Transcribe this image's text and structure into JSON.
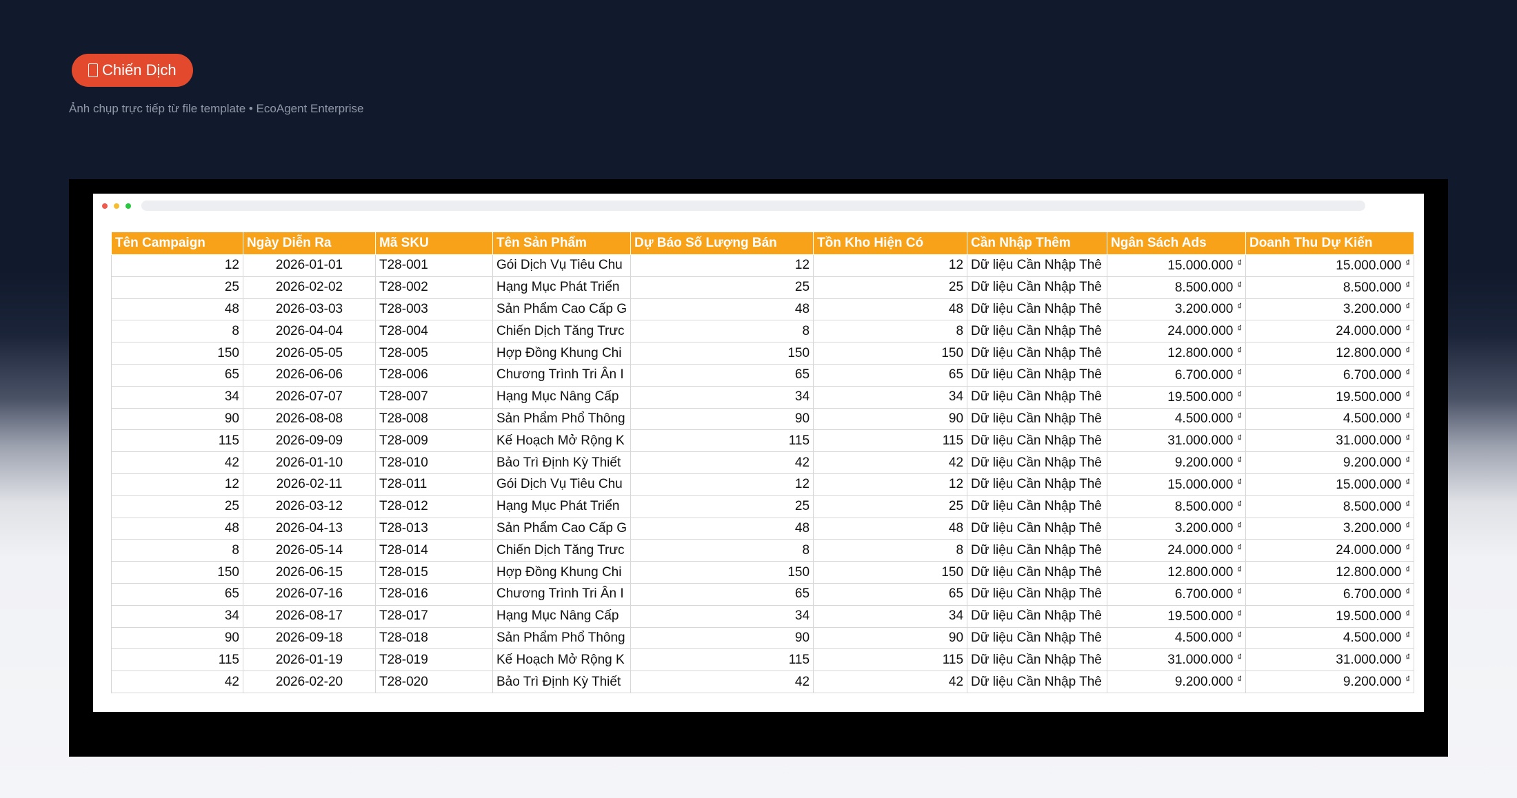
{
  "badge": {
    "icon": "document-icon",
    "label": "Chiến Dịch",
    "color": "#e2492d"
  },
  "caption": "Ảnh chụp trực tiếp từ file template • EcoAgent Enterprise",
  "window": {
    "dot_colors": [
      "#f05b50",
      "#f6be2f",
      "#29c840"
    ]
  },
  "sheet": {
    "header_color": "#f8a21a",
    "currency_symbol": "₫",
    "columns": [
      "Tên Campaign",
      "Ngày Diễn Ra",
      "Mã SKU",
      "Tên Sản Phẩm",
      "Dự Báo Số Lượng Bán",
      "Tồn Kho Hiện Có",
      "Cần Nhập Thêm",
      "Ngân Sách Ads",
      "Doanh Thu Dự Kiến"
    ],
    "rows": [
      [
        "12",
        "2026-01-01",
        "T28-001",
        "Gói Dịch Vụ Tiêu Chu",
        "12",
        "12",
        "Dữ liệu Cần Nhập Thê",
        "15.000.000",
        "15.000.000"
      ],
      [
        "25",
        "2026-02-02",
        "T28-002",
        "Hạng Mục Phát Triển",
        "25",
        "25",
        "Dữ liệu Cần Nhập Thê",
        "8.500.000",
        "8.500.000"
      ],
      [
        "48",
        "2026-03-03",
        "T28-003",
        "Sản Phẩm Cao Cấp G",
        "48",
        "48",
        "Dữ liệu Cần Nhập Thê",
        "3.200.000",
        "3.200.000"
      ],
      [
        "8",
        "2026-04-04",
        "T28-004",
        "Chiến Dịch Tăng Trưc",
        "8",
        "8",
        "Dữ liệu Cần Nhập Thê",
        "24.000.000",
        "24.000.000"
      ],
      [
        "150",
        "2026-05-05",
        "T28-005",
        "Hợp Đồng Khung Chi",
        "150",
        "150",
        "Dữ liệu Cần Nhập Thê",
        "12.800.000",
        "12.800.000"
      ],
      [
        "65",
        "2026-06-06",
        "T28-006",
        "Chương Trình Tri Ân I",
        "65",
        "65",
        "Dữ liệu Cần Nhập Thê",
        "6.700.000",
        "6.700.000"
      ],
      [
        "34",
        "2026-07-07",
        "T28-007",
        "Hạng Mục Nâng Cấp",
        "34",
        "34",
        "Dữ liệu Cần Nhập Thê",
        "19.500.000",
        "19.500.000"
      ],
      [
        "90",
        "2026-08-08",
        "T28-008",
        "Sản Phẩm Phổ Thông",
        "90",
        "90",
        "Dữ liệu Cần Nhập Thê",
        "4.500.000",
        "4.500.000"
      ],
      [
        "115",
        "2026-09-09",
        "T28-009",
        "Kế Hoạch Mở Rộng K",
        "115",
        "115",
        "Dữ liệu Cần Nhập Thê",
        "31.000.000",
        "31.000.000"
      ],
      [
        "42",
        "2026-01-10",
        "T28-010",
        "Bảo Trì Định Kỳ Thiết",
        "42",
        "42",
        "Dữ liệu Cần Nhập Thê",
        "9.200.000",
        "9.200.000"
      ],
      [
        "12",
        "2026-02-11",
        "T28-011",
        "Gói Dịch Vụ Tiêu Chu",
        "12",
        "12",
        "Dữ liệu Cần Nhập Thê",
        "15.000.000",
        "15.000.000"
      ],
      [
        "25",
        "2026-03-12",
        "T28-012",
        "Hạng Mục Phát Triển",
        "25",
        "25",
        "Dữ liệu Cần Nhập Thê",
        "8.500.000",
        "8.500.000"
      ],
      [
        "48",
        "2026-04-13",
        "T28-013",
        "Sản Phẩm Cao Cấp G",
        "48",
        "48",
        "Dữ liệu Cần Nhập Thê",
        "3.200.000",
        "3.200.000"
      ],
      [
        "8",
        "2026-05-14",
        "T28-014",
        "Chiến Dịch Tăng Trưc",
        "8",
        "8",
        "Dữ liệu Cần Nhập Thê",
        "24.000.000",
        "24.000.000"
      ],
      [
        "150",
        "2026-06-15",
        "T28-015",
        "Hợp Đồng Khung Chi",
        "150",
        "150",
        "Dữ liệu Cần Nhập Thê",
        "12.800.000",
        "12.800.000"
      ],
      [
        "65",
        "2026-07-16",
        "T28-016",
        "Chương Trình Tri Ân I",
        "65",
        "65",
        "Dữ liệu Cần Nhập Thê",
        "6.700.000",
        "6.700.000"
      ],
      [
        "34",
        "2026-08-17",
        "T28-017",
        "Hạng Mục Nâng Cấp",
        "34",
        "34",
        "Dữ liệu Cần Nhập Thê",
        "19.500.000",
        "19.500.000"
      ],
      [
        "90",
        "2026-09-18",
        "T28-018",
        "Sản Phẩm Phổ Thông",
        "90",
        "90",
        "Dữ liệu Cần Nhập Thê",
        "4.500.000",
        "4.500.000"
      ],
      [
        "115",
        "2026-01-19",
        "T28-019",
        "Kế Hoạch Mở Rộng K",
        "115",
        "115",
        "Dữ liệu Cần Nhập Thê",
        "31.000.000",
        "31.000.000"
      ],
      [
        "42",
        "2026-02-20",
        "T28-020",
        "Bảo Trì Định Kỳ Thiết",
        "42",
        "42",
        "Dữ liệu Cần Nhập Thê",
        "9.200.000",
        "9.200.000"
      ]
    ]
  }
}
